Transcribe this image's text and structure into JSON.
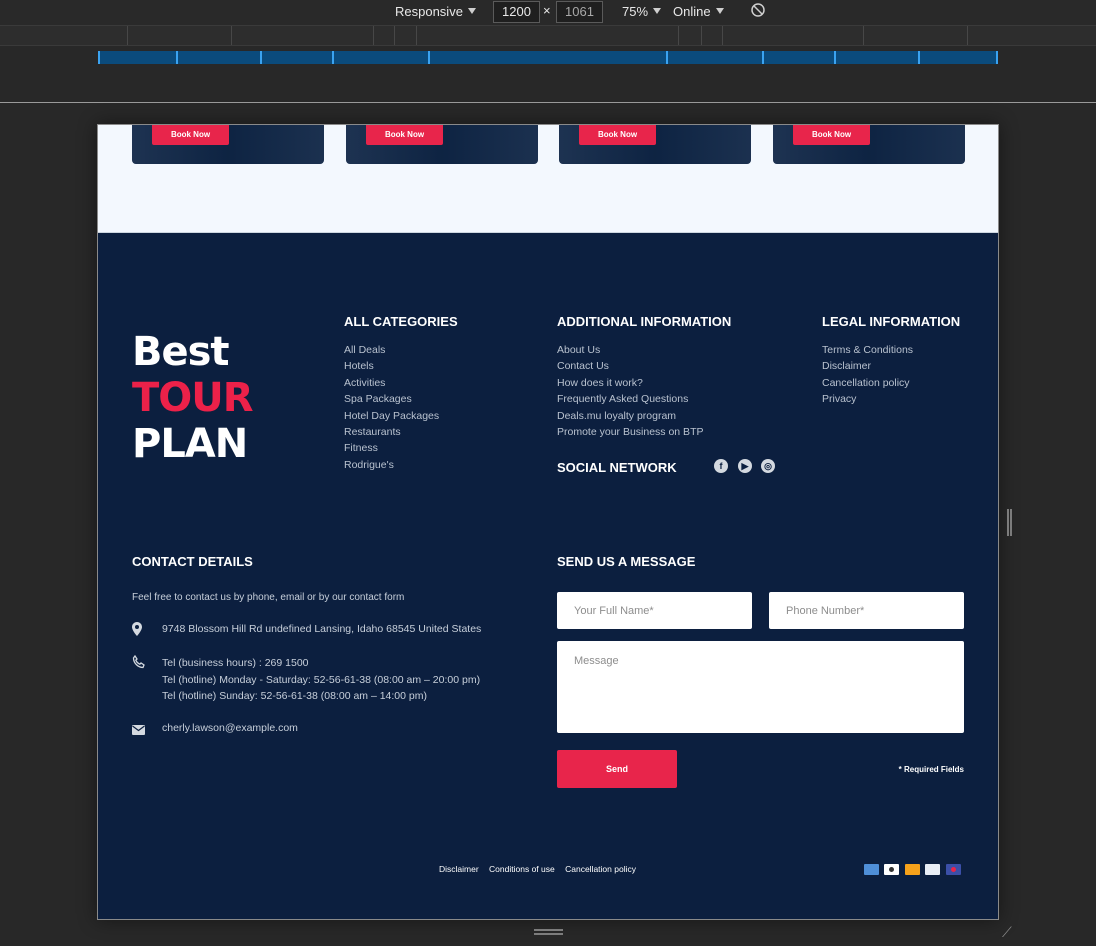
{
  "devtools": {
    "device": "Responsive",
    "width": "1200",
    "times": "×",
    "height": "1061",
    "zoom": "75%",
    "throttle": "Online",
    "rotate_icon": "rotate-icon"
  },
  "cards": [
    {
      "button": "Book Now"
    },
    {
      "button": "Book Now"
    },
    {
      "button": "Book Now"
    },
    {
      "button": "Book Now"
    }
  ],
  "logo": {
    "line1": "Best",
    "line2": "TOUR",
    "line3": "PLAN"
  },
  "categories": {
    "title": "ALL CATEGORIES",
    "items": [
      "All Deals",
      "Hotels",
      "Activities",
      "Spa Packages",
      "Hotel Day Packages",
      "Restaurants",
      "Fitness",
      "Rodrigue's"
    ]
  },
  "additional": {
    "title": "ADDITIONAL INFORMATION",
    "items": [
      "About Us",
      "Contact Us",
      "How does it work?",
      "Frequently Asked Questions",
      "Deals.mu loyalty program",
      "Promote your Business on BTP"
    ]
  },
  "legal": {
    "title": "LEGAL INFORMATION",
    "items": [
      "Terms & Conditions",
      "Disclaimer",
      "Cancellation policy",
      "Privacy"
    ]
  },
  "social": {
    "title": "SOCIAL NETWORK",
    "icons": [
      "facebook-icon",
      "youtube-icon",
      "instagram-icon"
    ]
  },
  "contact": {
    "title": "CONTACT DETAILS",
    "intro": "Feel free to contact us by phone, email or by our contact form",
    "address": "9748 Blossom Hill Rd undefined Lansing, Idaho 68545 United States",
    "phone1": "Tel (business hours) : 269 1500",
    "phone2": "Tel (hotline) Monday - Saturday: 52-56-61-38 (08:00 am – 20:00 pm)",
    "phone3": "Tel (hotline) Sunday: 52-56-61-38 (08:00 am – 14:00 pm)",
    "email": "cherly.lawson@example.com"
  },
  "message_form": {
    "title": "SEND US A MESSAGE",
    "name_placeholder": "Your Full Name*",
    "phone_placeholder": "Phone Number*",
    "message_placeholder": "Message",
    "send_label": "Send",
    "required_note": "* Required Fields"
  },
  "bottom": {
    "links": [
      "Disclaimer",
      "Conditions of use",
      "Cancellation policy"
    ],
    "payment_icons": [
      "amex-icon",
      "card-icon",
      "bitcoin-icon",
      "paypal-icon",
      "mastercard-icon"
    ]
  },
  "colors": {
    "footer_bg": "#0c1f3f",
    "accent": "#e8254b",
    "top_band": "#f3f8fe"
  }
}
